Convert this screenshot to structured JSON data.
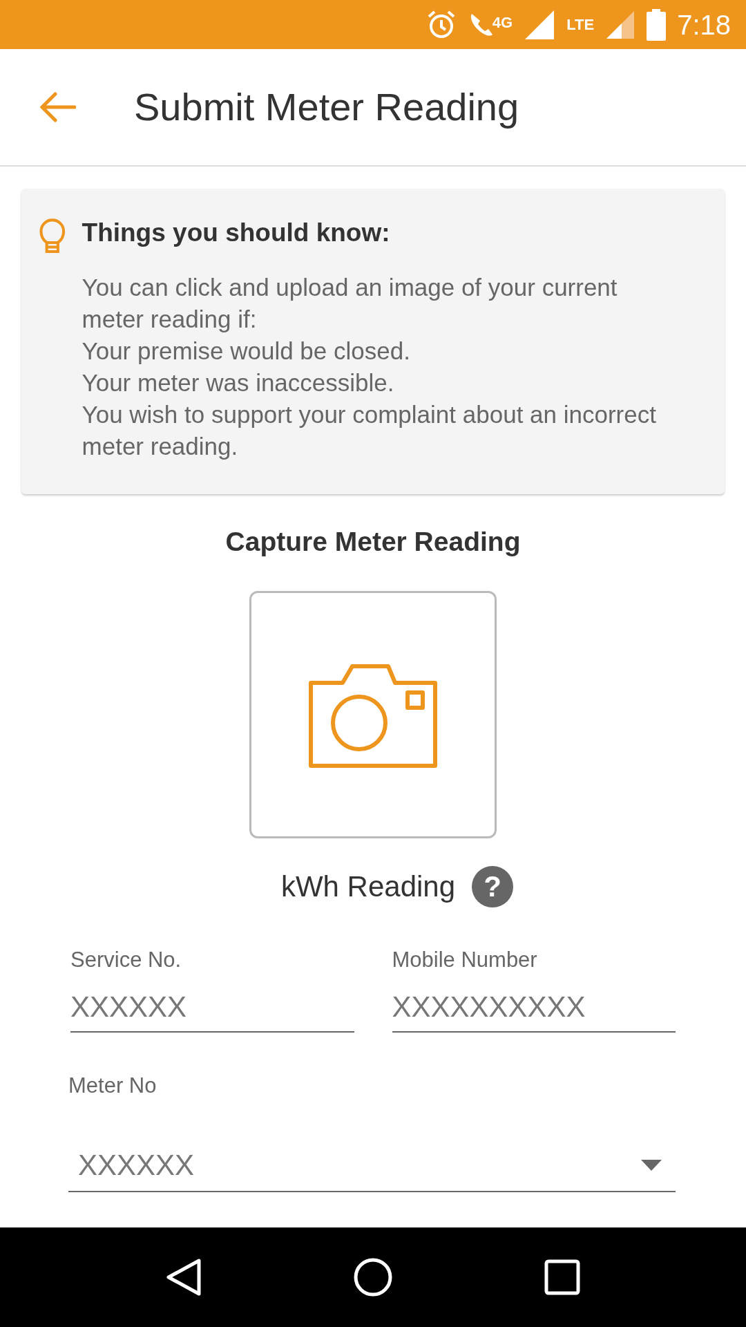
{
  "status_bar": {
    "network_label": "4G",
    "lte_label": "LTE",
    "time": "7:18"
  },
  "app_bar": {
    "title": "Submit Meter Reading"
  },
  "info_card": {
    "heading": "Things you should know:",
    "intro": "You can click and upload an image of your current meter reading if:",
    "items": [
      "Your premise would be closed.",
      "Your meter was inaccessible.",
      "You wish to support your complaint about an incorrect meter reading."
    ]
  },
  "capture": {
    "heading": "Capture Meter Reading",
    "reading_label": "kWh Reading",
    "help": "?"
  },
  "fields": [
    {
      "label": "Service No.",
      "placeholder": "XXXXXX"
    },
    {
      "label": "Mobile Number",
      "placeholder": "XXXXXXXXXX"
    }
  ],
  "meter_select": {
    "label": "Meter No",
    "value": "XXXXXX"
  }
}
